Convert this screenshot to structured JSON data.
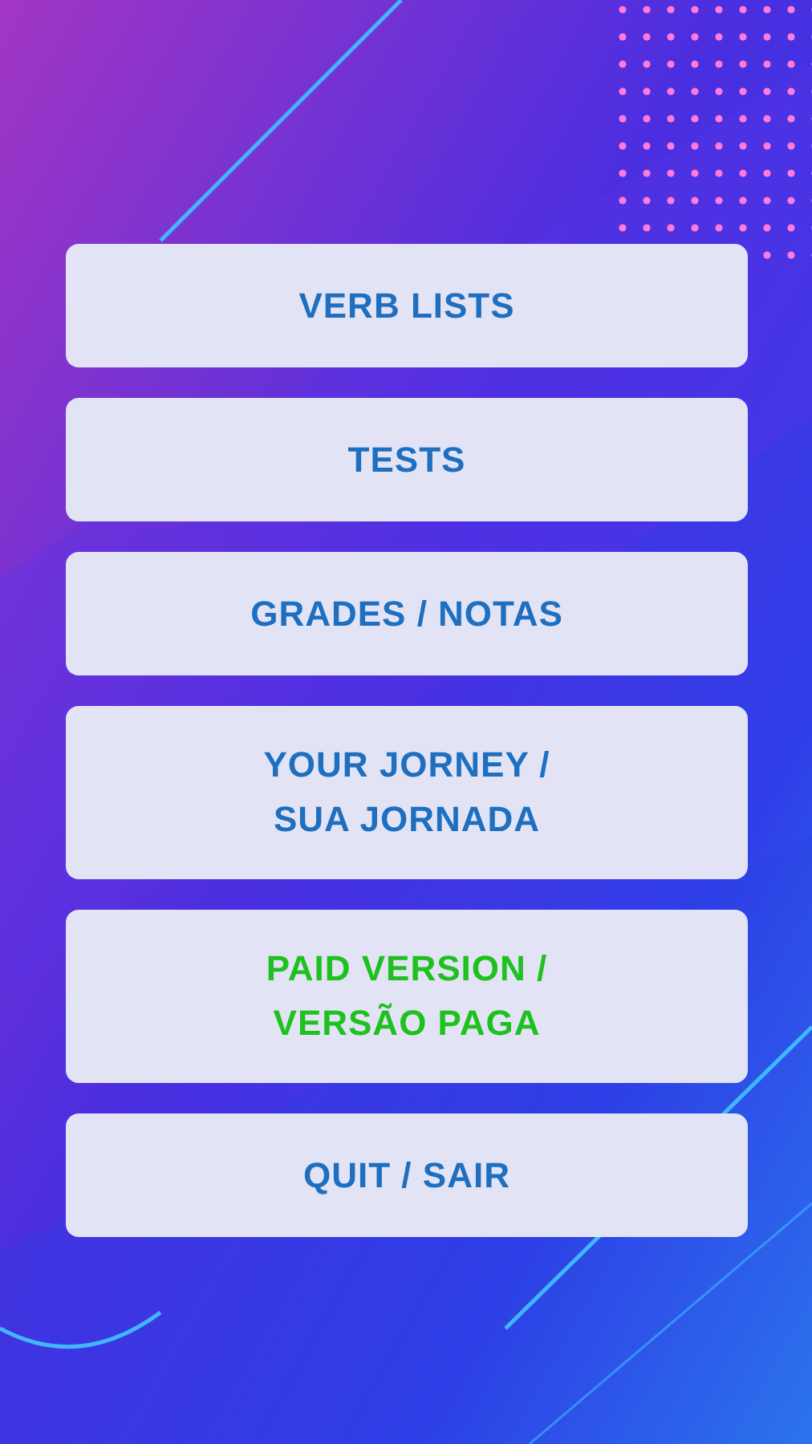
{
  "menu": [
    {
      "lines": [
        "VERB LISTS"
      ],
      "color": "#1e6fbf"
    },
    {
      "lines": [
        "TESTS"
      ],
      "color": "#1e6fbf"
    },
    {
      "lines": [
        "GRADES / NOTAS"
      ],
      "color": "#1e6fbf"
    },
    {
      "lines": [
        "YOUR JORNEY /",
        "SUA JORNADA"
      ],
      "color": "#1e6fbf"
    },
    {
      "lines": [
        "PAID VERSION /",
        "VERSÃO PAGA"
      ],
      "color": "#1fc11f"
    },
    {
      "lines": [
        "QUIT / SAIR"
      ],
      "color": "#1e6fbf"
    }
  ]
}
